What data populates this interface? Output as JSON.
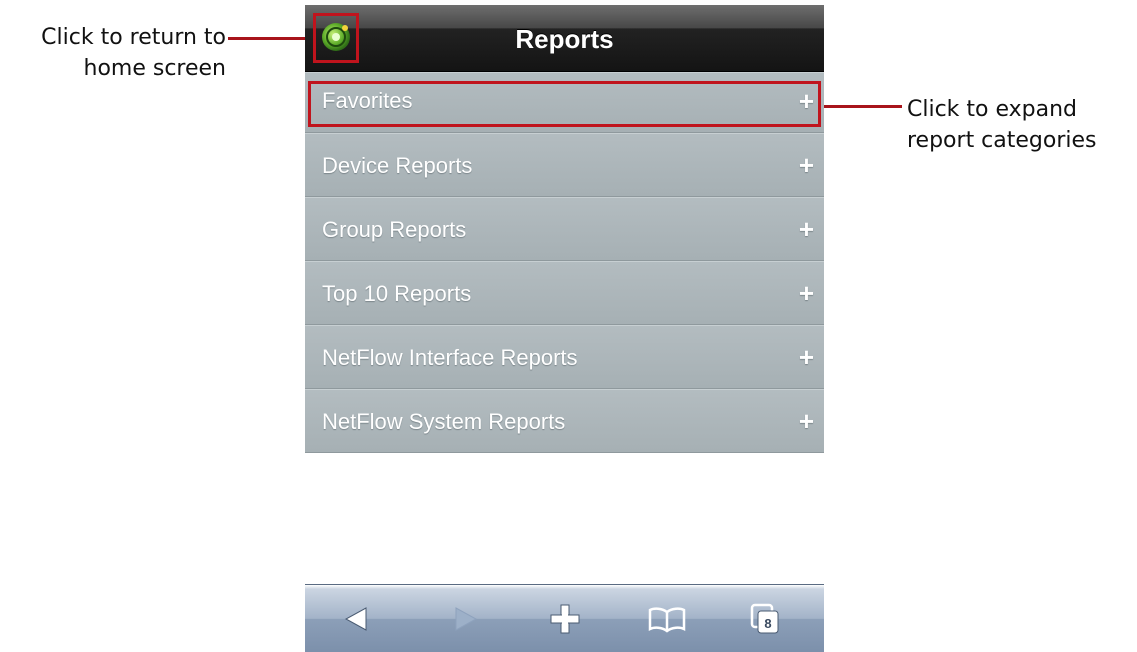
{
  "callouts": {
    "home": [
      "Click to return to",
      "home screen"
    ],
    "expand": [
      "Click to expand",
      "report categories"
    ]
  },
  "header": {
    "title": "Reports",
    "home_icon": "app-logo-icon"
  },
  "menu": {
    "items": [
      {
        "label": "Favorites",
        "expand_symbol": "+"
      },
      {
        "label": "Device Reports",
        "expand_symbol": "+"
      },
      {
        "label": "Group Reports",
        "expand_symbol": "+"
      },
      {
        "label": "Top 10 Reports",
        "expand_symbol": "+"
      },
      {
        "label": "NetFlow Interface Reports",
        "expand_symbol": "+"
      },
      {
        "label": "NetFlow System Reports",
        "expand_symbol": "+"
      }
    ]
  },
  "toolbar": {
    "back_icon": "back-arrow-icon",
    "forward_icon": "forward-arrow-icon",
    "add_icon": "plus-icon",
    "bookmarks_icon": "book-icon",
    "pages_icon": "pages-icon",
    "pages_count": "8"
  },
  "colors": {
    "callout_red": "#c0141d",
    "header_dark": "#141414",
    "menu_gray": "#aeb7bb",
    "toolbar_blue": "#8c9fb8"
  }
}
